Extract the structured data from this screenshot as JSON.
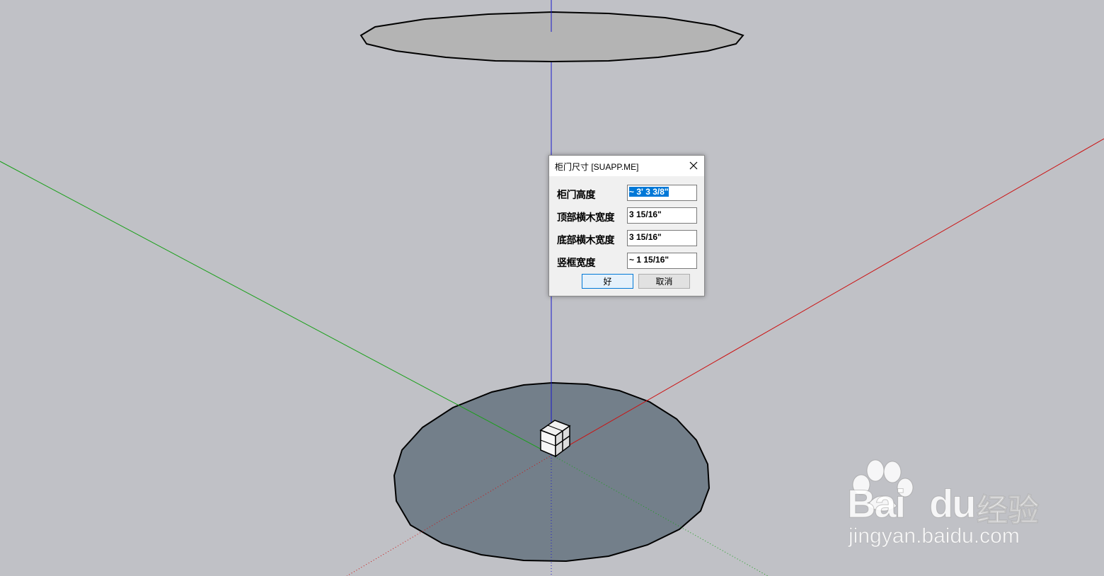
{
  "dialog": {
    "title": "柜门尺寸 [SUAPP.ME]",
    "fields": [
      {
        "label": "柜门高度",
        "value": "~ 3' 3 3/8\"",
        "selected": true
      },
      {
        "label": "顶部横木宽度",
        "value": "3 15/16\"",
        "selected": false
      },
      {
        "label": "底部横木宽度",
        "value": "3 15/16\"",
        "selected": false
      },
      {
        "label": "竖框宽度",
        "value": "~ 1 15/16\"",
        "selected": false
      }
    ],
    "ok_label": "好",
    "cancel_label": "取消"
  },
  "watermark": {
    "brand_left": "Bai",
    "brand_right": "du",
    "product": "经验",
    "url": "jingyan.baidu.com"
  },
  "colors": {
    "background": "#c0c1c6",
    "red_axis": "#cc0000",
    "green_axis": "#00a000",
    "blue_axis": "#0000cc",
    "bottom_disc": "#737f8a",
    "top_disc": "#b4b4b4",
    "selection": "#0078d7"
  },
  "icons": {
    "close": "close-icon",
    "watermark_paw": "baidu-paw-icon"
  }
}
